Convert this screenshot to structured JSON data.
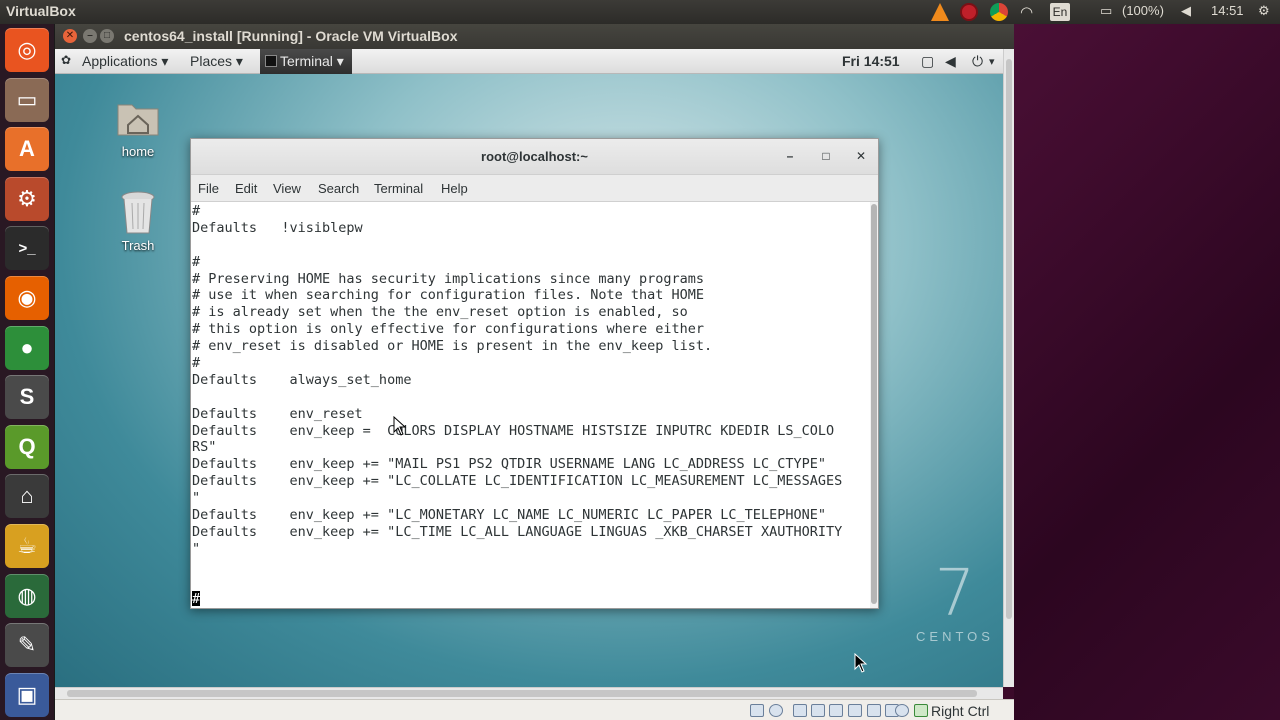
{
  "host": {
    "app_name": "VirtualBox",
    "tray": {
      "battery": "(100%)",
      "clock": "14:51",
      "keyboard_layout": "En"
    }
  },
  "launcher": {
    "items": [
      {
        "name": "ubuntu-home-icon",
        "glyph": "◎",
        "color": "#e95420"
      },
      {
        "name": "files-icon",
        "glyph": "▭",
        "color": "#8a6a55"
      },
      {
        "name": "software-center-icon",
        "glyph": "A",
        "color": "#e8702a"
      },
      {
        "name": "system-settings-icon",
        "glyph": "⚙",
        "color": "#b94a2c"
      },
      {
        "name": "terminal-icon",
        "glyph": ">_",
        "color": "#2b2b2b"
      },
      {
        "name": "firefox-icon",
        "glyph": "◉",
        "color": "#e66000"
      },
      {
        "name": "chrome-icon",
        "glyph": "●",
        "color": "#2d8f3a"
      },
      {
        "name": "sublime-text-icon",
        "glyph": "S",
        "color": "#4a4a4a"
      },
      {
        "name": "qgis-icon",
        "glyph": "Q",
        "color": "#5a9a2a"
      },
      {
        "name": "app-icon",
        "glyph": "⌂",
        "color": "#3a3a3a"
      },
      {
        "name": "teapot-icon",
        "glyph": "☕",
        "color": "#d8a020"
      },
      {
        "name": "globe-icon",
        "glyph": "◍",
        "color": "#2a6a3a"
      },
      {
        "name": "tools-icon",
        "glyph": "✎",
        "color": "#4a4a4a"
      },
      {
        "name": "virtualbox-icon",
        "glyph": "▣",
        "color": "#3a5a9a"
      }
    ]
  },
  "vbox": {
    "window_title": "centos64_install [Running] - Oracle VM VirtualBox",
    "status": {
      "host_key": "Right Ctrl"
    }
  },
  "guest": {
    "topbar": {
      "applications": "Applications ▾",
      "places": "Places ▾",
      "terminal": "Terminal ▾",
      "clock": "Fri 14:51"
    },
    "desktop_icons": [
      {
        "label": "home"
      },
      {
        "label": "Trash"
      }
    ],
    "logo": {
      "number": "7",
      "word": "CENTOS"
    }
  },
  "terminal": {
    "title": "root@localhost:~",
    "controls": {
      "minimize": "–",
      "maximize": "□",
      "close": "✕"
    },
    "menu": [
      "File",
      "Edit",
      "View",
      "Search",
      "Terminal",
      "Help"
    ],
    "lines": [
      "#",
      "Defaults   !visiblepw",
      "",
      "#",
      "# Preserving HOME has security implications since many programs",
      "# use it when searching for configuration files. Note that HOME",
      "# is already set when the the env_reset option is enabled, so",
      "# this option is only effective for configurations where either",
      "# env_reset is disabled or HOME is present in the env_keep list.",
      "#",
      "Defaults    always_set_home",
      "",
      "Defaults    env_reset",
      "Defaults    env_keep =  COLORS DISPLAY HOSTNAME HISTSIZE INPUTRC KDEDIR LS_COLO",
      "RS\"",
      "Defaults    env_keep += \"MAIL PS1 PS2 QTDIR USERNAME LANG LC_ADDRESS LC_CTYPE\"",
      "Defaults    env_keep += \"LC_COLLATE LC_IDENTIFICATION LC_MEASUREMENT LC_MESSAGES",
      "\"",
      "Defaults    env_keep += \"LC_MONETARY LC_NAME LC_NUMERIC LC_PAPER LC_TELEPHONE\"",
      "Defaults    env_keep += \"LC_TIME LC_ALL LANGUAGE LINGUAS _XKB_CHARSET XAUTHORITY",
      "\"",
      "",
      ""
    ],
    "prompt_line": "#"
  }
}
